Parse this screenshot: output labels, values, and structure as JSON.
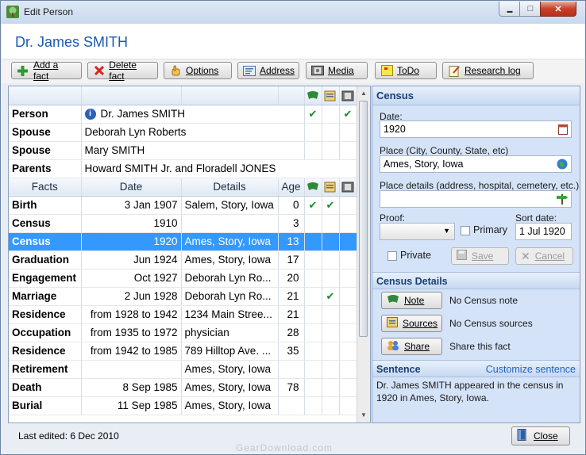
{
  "window": {
    "title": "Edit Person",
    "controls": {
      "minimize": "▬",
      "maximize": "□",
      "close": "✕"
    }
  },
  "header": {
    "person_name": "Dr. James SMITH"
  },
  "toolbar": {
    "buttons": [
      {
        "label": "Add a fact",
        "icon": "plus-icon"
      },
      {
        "label": "Delete fact",
        "icon": "red-x-icon"
      },
      {
        "label": "Options",
        "icon": "hand-icon"
      },
      {
        "label": "Address",
        "icon": "address-card-icon"
      },
      {
        "label": "Media",
        "icon": "film-icon"
      },
      {
        "label": "ToDo",
        "icon": "sticky-note-icon"
      },
      {
        "label": "Research log",
        "icon": "notepad-icon"
      }
    ]
  },
  "relations": [
    {
      "type": "Person",
      "name": "Dr. James SMITH",
      "check1": "✔",
      "check3": "✔"
    },
    {
      "type": "Spouse",
      "name": "Deborah Lyn Roberts"
    },
    {
      "type": "Spouse",
      "name": "Mary SMITH"
    },
    {
      "type": "Parents",
      "name": "Howard SMITH Jr. and Floradell JONES"
    }
  ],
  "facts_header": {
    "facts": "Facts",
    "date": "Date",
    "details": "Details",
    "age": "Age"
  },
  "facts": [
    {
      "type": "Birth",
      "date": "3 Jan 1907",
      "details": "Salem, Story, Iowa",
      "age": "0",
      "check1": "✔",
      "check2": "✔"
    },
    {
      "type": "Census",
      "date": "1910",
      "details": "",
      "age": "3"
    },
    {
      "type": "Census",
      "date": "1920",
      "details": "Ames, Story, Iowa",
      "age": "13",
      "selected": true
    },
    {
      "type": "Graduation",
      "date": "Jun 1924",
      "details": "Ames, Story, Iowa",
      "age": "17"
    },
    {
      "type": "Engagement",
      "date": "Oct 1927",
      "details": "Deborah Lyn Ro...",
      "age": "20"
    },
    {
      "type": "Marriage",
      "date": "2 Jun 1928",
      "details": "Deborah Lyn Ro...",
      "age": "21",
      "check2": "✔"
    },
    {
      "type": "Residence",
      "date": "from 1928 to 1942",
      "details": "1234 Main Stree...",
      "age": "21"
    },
    {
      "type": "Occupation",
      "date": "from 1935 to 1972",
      "details": "physician",
      "age": "28"
    },
    {
      "type": "Residence",
      "date": "from 1942 to 1985",
      "details": "789 Hilltop Ave. ...",
      "age": "35"
    },
    {
      "type": "Retirement",
      "date": "",
      "details": "Ames, Story, Iowa",
      "age": ""
    },
    {
      "type": "Death",
      "date": "8 Sep 1985",
      "details": "Ames, Story, Iowa",
      "age": "78"
    },
    {
      "type": "Burial",
      "date": "11 Sep 1985",
      "details": "Ames, Story, Iowa",
      "age": ""
    }
  ],
  "panel": {
    "section_title": "Census",
    "date_label": "Date:",
    "date_value": "1920",
    "place_label": "Place (City, County, State, etc)",
    "place_value": "Ames, Story, Iowa",
    "place_details_label": "Place details (address, hospital, cemetery, etc.)",
    "place_details_value": "",
    "proof_label": "Proof:",
    "proof_value": "",
    "primary_label": "Primary",
    "sort_date_label": "Sort date:",
    "sort_date_value": "1 Jul 1920",
    "private_label": "Private",
    "save_label": "Save",
    "cancel_label": "Cancel",
    "details_title": "Census Details",
    "note_button": "Note",
    "note_text": "No Census note",
    "sources_button": "Sources",
    "sources_text": "No Census sources",
    "share_button": "Share",
    "share_text": "Share this fact",
    "sentence_title": "Sentence",
    "customize_link": "Customize sentence",
    "sentence_text": "Dr. James SMITH appeared in the census in 1920 in Ames, Story, Iowa."
  },
  "footer": {
    "last_edited": "Last edited: 6 Dec 2010",
    "close_label": "Close",
    "watermark": "GearDownload.com"
  },
  "colors": {
    "accent": "#1e5ab4",
    "selection": "#3399ff",
    "check": "#1a8a2a"
  }
}
